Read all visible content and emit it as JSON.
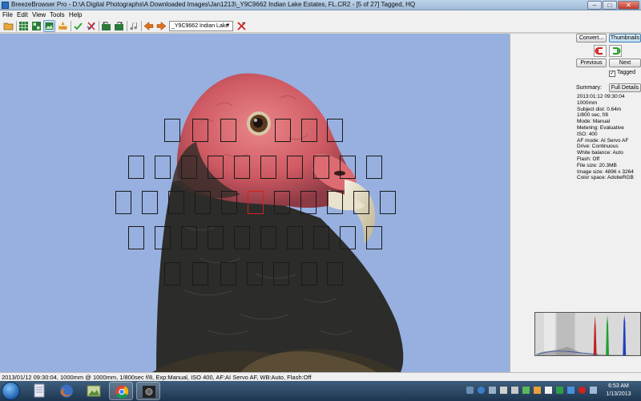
{
  "window": {
    "title": "BreezeBrowser Pro - D:\\A Digital Photographs\\A Downloaded Images\\Jan1213\\_Y9C9662  Indian Lake Estates, FL.CR2 - [5 of 27] Tagged, HQ",
    "min": "–",
    "max": "□",
    "close": "✕"
  },
  "menu": [
    "File",
    "Edit",
    "View",
    "Tools",
    "Help"
  ],
  "toolbar": {
    "icons": [
      "open-folder-icon",
      "grid-view-icon",
      "thumbs-view-icon",
      "single-view-icon",
      "raw-icon",
      "tag-icon",
      "untag-icon",
      "rotate-left-icon",
      "rotate-right-icon",
      "audio-icon",
      "previous-arrow-icon",
      "next-arrow-icon",
      "delete-icon"
    ],
    "file_select": "_Y9C9662  Indian Lake",
    "file_select_arrow": "▼"
  },
  "panel": {
    "convert": "Convert...",
    "thumbnails": "Thumbnails",
    "previous": "Previous",
    "next": "Next",
    "tagged_label": "Tagged",
    "tagged_checked": true,
    "check_mark": "✓",
    "summary_label": "Summary:",
    "full_details": "Full Details",
    "metadata": [
      "2013:01:12 09:30:04",
      "1000mm",
      "Subject dist: 0.64m",
      "1/800 sec, f/8",
      "Mode: Manual",
      "Metering: Evaluative",
      "ISO: 400",
      "AF mode: AI Servo AF",
      "Drive: Continuous",
      "White balance: Auto",
      "Flash: Off",
      "File size: 20.3MB",
      "Image size: 4896 x 3264",
      "Color space: AdobeRGB"
    ]
  },
  "status_bar": "2013/01/12 09:30:04, 1000mm @ 1000mm, 1/800sec f/8, Exp:Manual, ISO 400, AF:AI Servo AF, WB:Auto, Flash:Off",
  "taskbar": {
    "apps": [
      "file-explorer-icon",
      "firefox-icon",
      "photos-icon",
      "chrome-icon",
      "breezebrowser-icon"
    ],
    "time": "6:53 AM",
    "date": "1/13/2013"
  },
  "colors": {
    "sky": "#97b0e0",
    "af_point": "#1a1a1a",
    "af_point_active": "#d42020",
    "selected_button": "#bfdcf3"
  }
}
